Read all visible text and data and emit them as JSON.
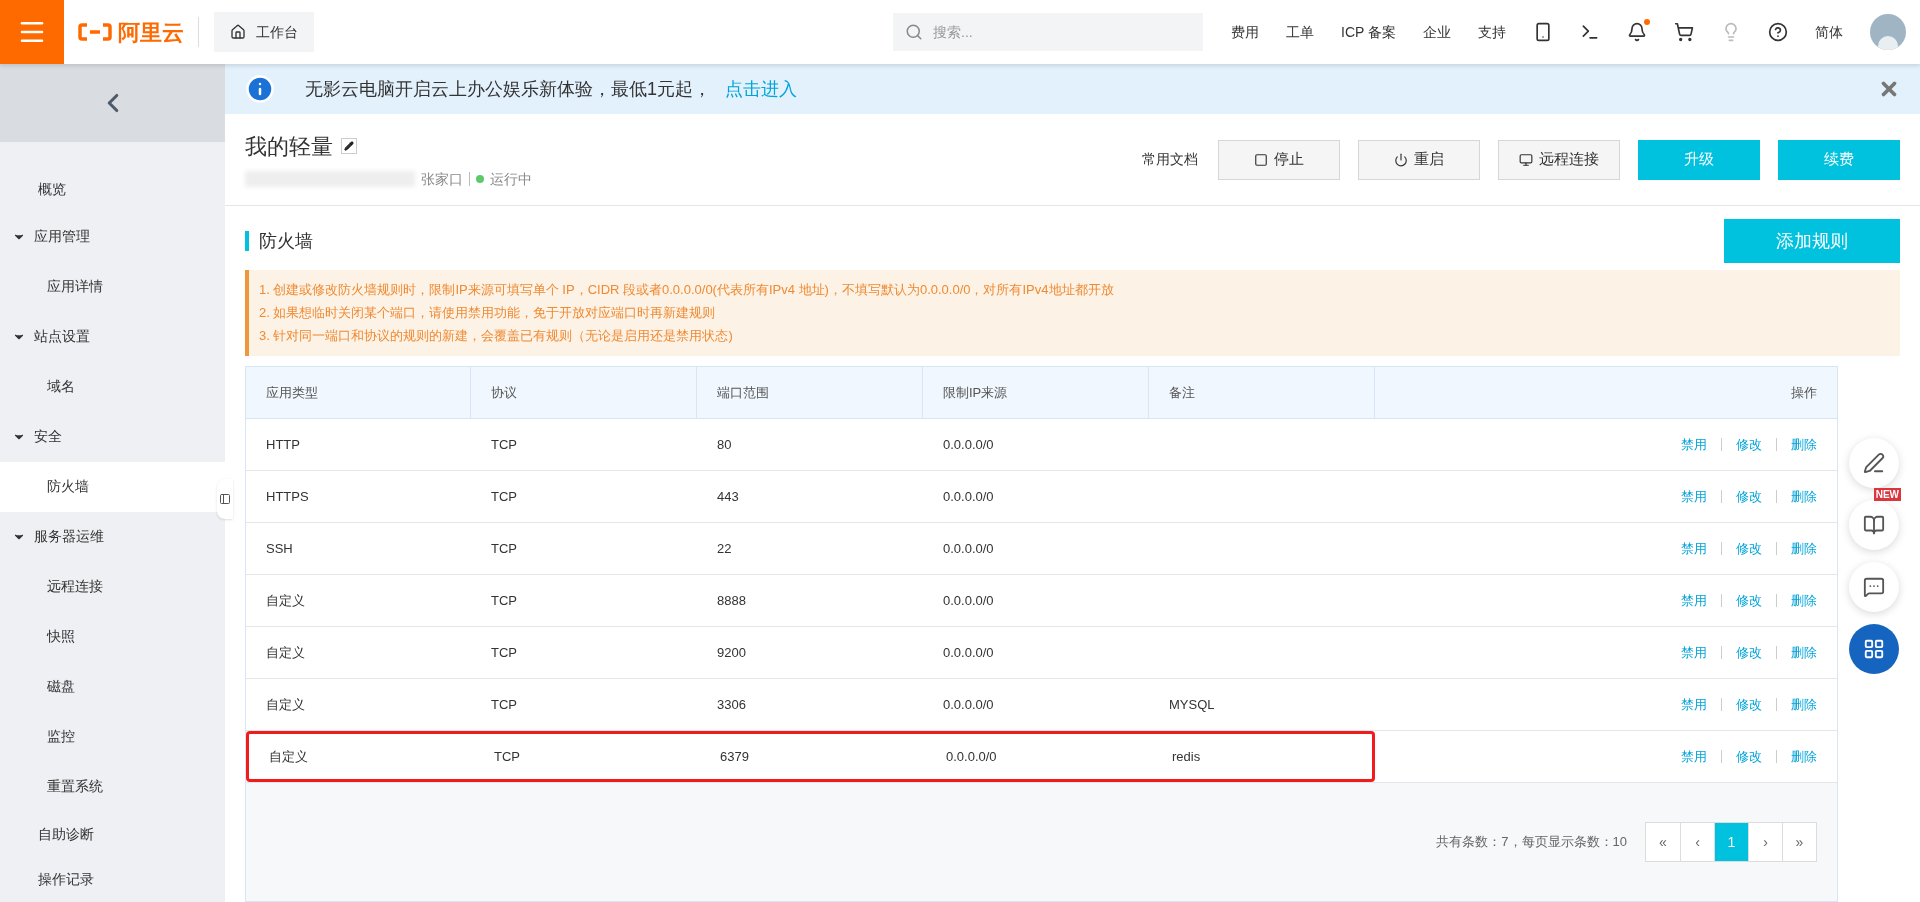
{
  "topbar": {
    "logo": "阿里云",
    "workbench": "工作台",
    "search": {
      "placeholder": "搜索..."
    },
    "nav": [
      "费用",
      "工单",
      "ICP 备案",
      "企业",
      "支持"
    ],
    "notification_dot": true,
    "language": "简体"
  },
  "banner": {
    "text": "无影云电脑开启云上办公娱乐新体验，最低1元起，",
    "link": "点击进入"
  },
  "sidebar": {
    "items": [
      {
        "label": "概览",
        "selected": false
      },
      {
        "label": "应用管理",
        "expanded": true,
        "children": [
          {
            "label": "应用详情",
            "selected": false
          }
        ]
      },
      {
        "label": "站点设置",
        "expanded": true,
        "children": [
          {
            "label": "域名",
            "selected": false
          }
        ]
      },
      {
        "label": "安全",
        "expanded": true,
        "children": [
          {
            "label": "防火墙",
            "selected": true
          }
        ]
      },
      {
        "label": "服务器运维",
        "expanded": true,
        "children": [
          {
            "label": "远程连接",
            "selected": false
          },
          {
            "label": "快照",
            "selected": false
          },
          {
            "label": "磁盘",
            "selected": false
          },
          {
            "label": "监控",
            "selected": false
          },
          {
            "label": "重置系统",
            "selected": false
          }
        ]
      },
      {
        "label": "自助诊断",
        "selected": false
      },
      {
        "label": "操作记录",
        "selected": false
      }
    ]
  },
  "instance": {
    "name": "我的轻量",
    "region": "张家口",
    "status": "运行中",
    "docs": "常用文档",
    "buttons": [
      {
        "label": "停止",
        "kind": "stop"
      },
      {
        "label": "重启",
        "kind": "restart"
      },
      {
        "label": "远程连接",
        "kind": "remote"
      },
      {
        "label": "升级",
        "kind": "primary"
      },
      {
        "label": "续费",
        "kind": "primary"
      }
    ]
  },
  "firewall": {
    "title": "防火墙",
    "add_button": "添加规则",
    "notes": [
      "1. 创建或修改防火墙规则时，限制IP来源可填写单个 IP，CIDR 段或者0.0.0.0/0(代表所有IPv4 地址)，不填写默认为0.0.0.0/0，对所有IPv4地址都开放",
      "2. 如果想临时关闭某个端口，请使用禁用功能，免于开放对应端口时再新建规则",
      "3. 针对同一端口和协议的规则的新建，会覆盖已有规则（无论是启用还是禁用状态)"
    ],
    "table": {
      "columns": [
        "应用类型",
        "协议",
        "端口范围",
        "限制IP来源",
        "备注",
        "操作"
      ],
      "rows": [
        {
          "cells": [
            "HTTP",
            "TCP",
            "80",
            "0.0.0.0/0",
            ""
          ],
          "actions": [
            "禁用",
            "修改",
            "删除"
          ],
          "annotated": false
        },
        {
          "cells": [
            "HTTPS",
            "TCP",
            "443",
            "0.0.0.0/0",
            ""
          ],
          "actions": [
            "禁用",
            "修改",
            "删除"
          ],
          "annotated": false
        },
        {
          "cells": [
            "SSH",
            "TCP",
            "22",
            "0.0.0.0/0",
            ""
          ],
          "actions": [
            "禁用",
            "修改",
            "删除"
          ],
          "annotated": false
        },
        {
          "cells": [
            "自定义",
            "TCP",
            "8888",
            "0.0.0.0/0",
            ""
          ],
          "actions": [
            "禁用",
            "修改",
            "删除"
          ],
          "annotated": false
        },
        {
          "cells": [
            "自定义",
            "TCP",
            "9200",
            "0.0.0.0/0",
            ""
          ],
          "actions": [
            "禁用",
            "修改",
            "删除"
          ],
          "annotated": false
        },
        {
          "cells": [
            "自定义",
            "TCP",
            "3306",
            "0.0.0.0/0",
            "MYSQL"
          ],
          "actions": [
            "禁用",
            "修改",
            "删除"
          ],
          "annotated": false
        },
        {
          "cells": [
            "自定义",
            "TCP",
            "6379",
            "0.0.0.0/0",
            "redis"
          ],
          "actions": [
            "禁用",
            "修改",
            "删除"
          ],
          "annotated": true
        }
      ]
    },
    "summary": "共有条数：7，每页显示条数：10",
    "pagination": [
      {
        "label": "«",
        "selected": false
      },
      {
        "label": "‹",
        "selected": false
      },
      {
        "label": "1",
        "selected": true
      },
      {
        "label": "›",
        "selected": false
      },
      {
        "label": "»",
        "selected": false
      }
    ]
  },
  "float_badge": "NEW"
}
